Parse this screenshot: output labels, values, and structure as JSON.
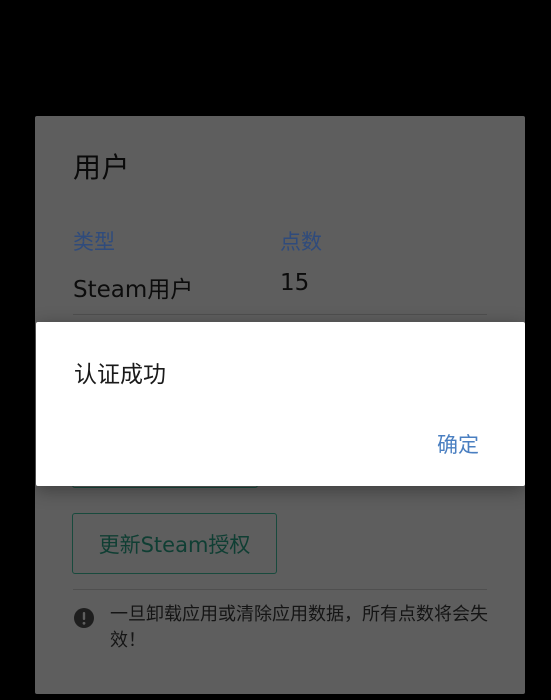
{
  "card": {
    "title": "用户",
    "columns": [
      {
        "label": "类型",
        "value": "Steam用户"
      },
      {
        "label": "点数",
        "value": "15"
      }
    ],
    "update_button_label": "更新Steam授权",
    "warning_text": "一旦卸载应用或清除应用数据，所有点数将会失效！"
  },
  "dialog": {
    "message": "认证成功",
    "ok_label": "确定"
  },
  "colors": {
    "background": "#000000",
    "card_dimmed": "#5e5e5e",
    "dialog_bg": "#ffffff",
    "accent_link": "#4a7fc1",
    "label_blue_dimmed": "#2f4b7c",
    "button_outline_green_dimmed": "#184a3d"
  },
  "icons": {
    "warning": "exclamation-circle-icon"
  }
}
